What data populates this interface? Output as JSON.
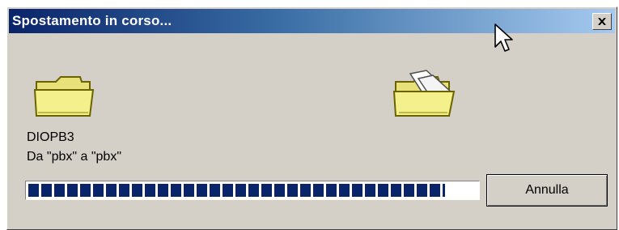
{
  "dialog": {
    "title": "Spostamento in corso...",
    "filename": "DIOPB3",
    "from_to": "Da \"pbx\" a \"pbx\"",
    "progress_fraction": 0.93,
    "cancel_label": "Annulla"
  },
  "icons": {
    "close": "close-icon",
    "source": "folder-icon",
    "destination": "folder-open-icon"
  },
  "colors": {
    "title_start": "#0a246a",
    "title_end": "#a6caf0",
    "face": "#d4d0c8",
    "progress": "#0a246a"
  }
}
